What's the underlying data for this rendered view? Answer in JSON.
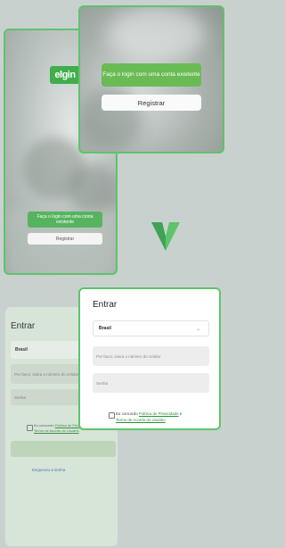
{
  "splash_back": {
    "logo": "elgin",
    "login_button": "Faça o login com uma conta existente",
    "register_button": "Registrar"
  },
  "splash_front": {
    "login_button": "Faça o login com uma conta existente",
    "register_button": "Registrar"
  },
  "checkmark": {
    "icon": "checkmark-icon",
    "color": "#3fae6b"
  },
  "form_back": {
    "title": "Entrar",
    "country_value": "Brasil",
    "phone_placeholder": "Por favor, insira o número do celular",
    "password_placeholder": "Senha",
    "terms_prefix": "Eu concordo",
    "terms_link1": "Política de Privacidade",
    "terms_link2": "Termo de Acordo do Usuário",
    "forgot_link": "Esqueceu a senha"
  },
  "form_front": {
    "title": "Entrar",
    "country_value": "Brasil",
    "phone_placeholder": "Por favor, insira o número do celular",
    "password_placeholder": "Senha",
    "terms_prefix": "Eu concordo",
    "terms_link1": "Política de Privacidade",
    "terms_and": " e",
    "terms_link2": "Termo de Acordo do Usuário"
  },
  "colors": {
    "brand_green": "#5fc36b",
    "background": "#c9d1cf"
  }
}
